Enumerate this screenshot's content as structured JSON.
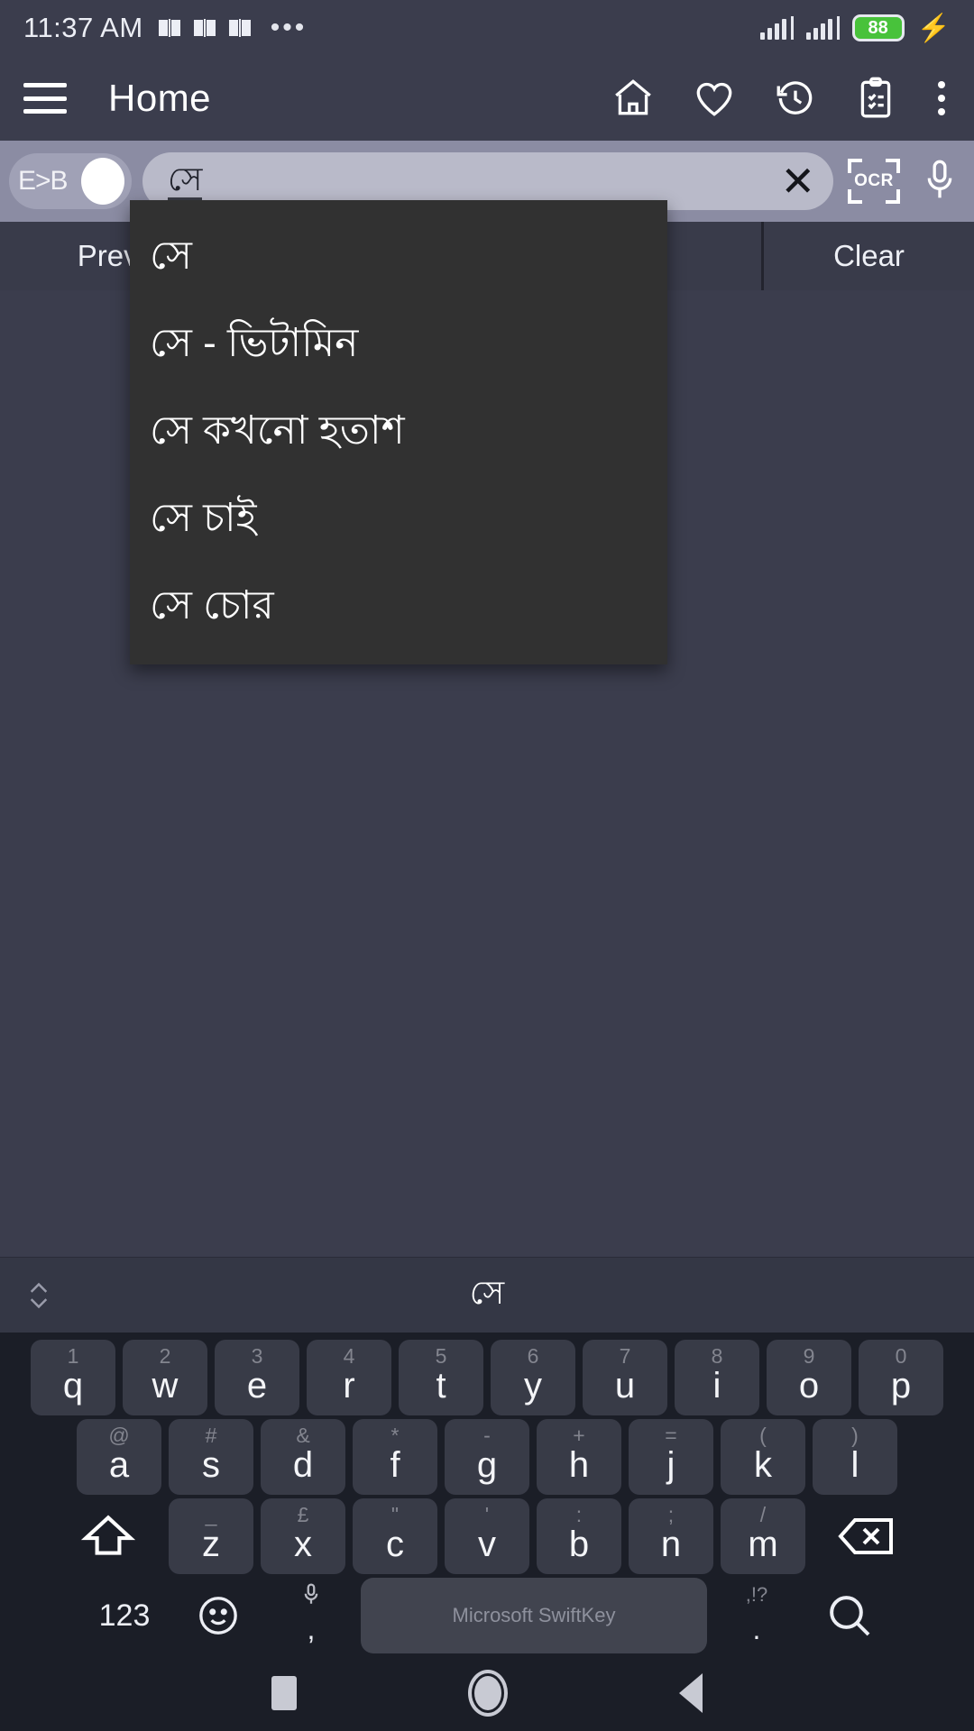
{
  "status_bar": {
    "time": "11:37 AM",
    "icons": [
      "book-icon",
      "book-icon",
      "book-icon"
    ],
    "overflow": "•••",
    "battery_percent": "88",
    "battery_color": "#48c23b",
    "charging": true,
    "signal_bars": 2
  },
  "app_bar": {
    "title": "Home",
    "menu_icon": "hamburger-icon",
    "actions": [
      "home-icon",
      "heart-icon",
      "history-icon",
      "clipboard-check-icon",
      "overflow-menu-icon"
    ]
  },
  "search_row": {
    "direction_toggle_label": "E>B",
    "toggle_on": true,
    "query": "সে",
    "placeholder": "",
    "clear_icon": "close-icon",
    "ocr_label": "OCR",
    "mic_icon": "microphone-icon"
  },
  "action_bar": {
    "previous_label": "Previous",
    "clear_label": "Clear"
  },
  "suggestions": [
    "সে",
    "সে - ভিটামিন",
    "সে কখনো হতাশ",
    "সে চাই",
    "সে চোর"
  ],
  "keyboard": {
    "suggestion_word": "সে",
    "expand_icon": "chevron-updown-icon",
    "row1": [
      {
        "key": "q",
        "hint": "1"
      },
      {
        "key": "w",
        "hint": "2"
      },
      {
        "key": "e",
        "hint": "3"
      },
      {
        "key": "r",
        "hint": "4"
      },
      {
        "key": "t",
        "hint": "5"
      },
      {
        "key": "y",
        "hint": "6"
      },
      {
        "key": "u",
        "hint": "7"
      },
      {
        "key": "i",
        "hint": "8"
      },
      {
        "key": "o",
        "hint": "9"
      },
      {
        "key": "p",
        "hint": "0"
      }
    ],
    "row2": [
      {
        "key": "a",
        "hint": "@"
      },
      {
        "key": "s",
        "hint": "#"
      },
      {
        "key": "d",
        "hint": "&"
      },
      {
        "key": "f",
        "hint": "*"
      },
      {
        "key": "g",
        "hint": "-"
      },
      {
        "key": "h",
        "hint": "+"
      },
      {
        "key": "j",
        "hint": "="
      },
      {
        "key": "k",
        "hint": "("
      },
      {
        "key": "l",
        "hint": ")"
      }
    ],
    "row3": [
      {
        "key": "z",
        "hint": "_"
      },
      {
        "key": "x",
        "hint": "£"
      },
      {
        "key": "c",
        "hint": "\""
      },
      {
        "key": "v",
        "hint": "'"
      },
      {
        "key": "b",
        "hint": ":"
      },
      {
        "key": "n",
        "hint": ";"
      },
      {
        "key": "m",
        "hint": "/"
      }
    ],
    "shift_icon": "shift-up-icon",
    "backspace_icon": "backspace-icon",
    "numeric_label": "123",
    "emoji_icon": "emoji-smiley-icon",
    "comma_key": ",",
    "comma_hint_icon": "microphone-icon",
    "space_label": "Microsoft SwiftKey",
    "period_key": ".",
    "period_hint": ",!?",
    "search_icon": "search-icon"
  },
  "system_nav": {
    "recents": "square-icon",
    "home": "circle-icon",
    "back": "triangle-back-icon"
  }
}
